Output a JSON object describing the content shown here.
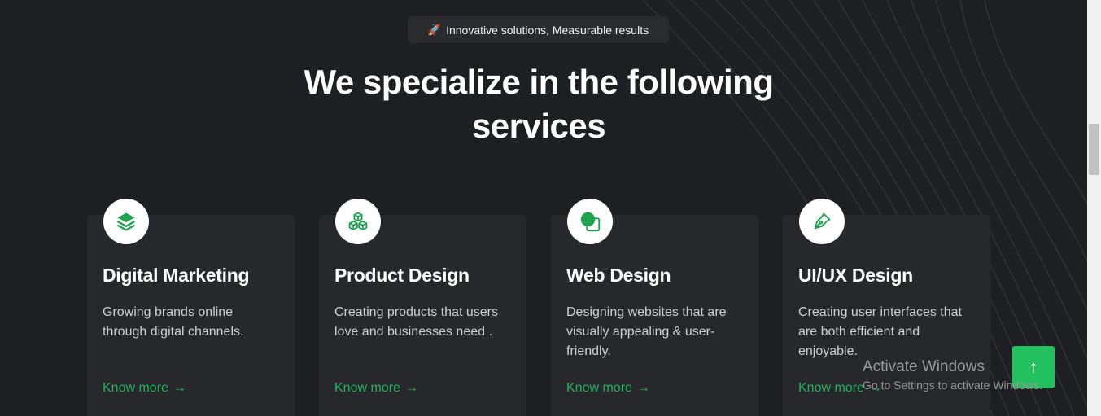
{
  "badge": {
    "icon": "rocket-icon",
    "text": "Innovative solutions, Measurable results"
  },
  "headline": {
    "line1": "We specialize in the following",
    "line2": "services"
  },
  "services": [
    {
      "icon": "layers-icon",
      "title": "Digital Marketing",
      "description": "Growing brands online through digital channels.",
      "link": "Know more"
    },
    {
      "icon": "cubes-icon",
      "title": "Product Design",
      "description": "Creating products that users love and businesses need .",
      "link": "Know more"
    },
    {
      "icon": "shapes-icon",
      "title": "Web Design",
      "description": "Designing websites that are visually appealing & user-friendly.",
      "link": "Know more"
    },
    {
      "icon": "pen-nib-icon",
      "title": "UI/UX Design",
      "description": "Creating user interfaces that are both efficient and enjoyable.",
      "link": "Know more"
    }
  ],
  "scroll_to_top": {
    "icon": "arrow-up-icon"
  },
  "activate_windows": {
    "title": "Activate Windows",
    "subtitle": "Go to Settings to activate Windows."
  },
  "colors": {
    "background": "#1e1f22",
    "card": "#27282c",
    "accent": "#22b45a",
    "button": "#22c05f"
  }
}
